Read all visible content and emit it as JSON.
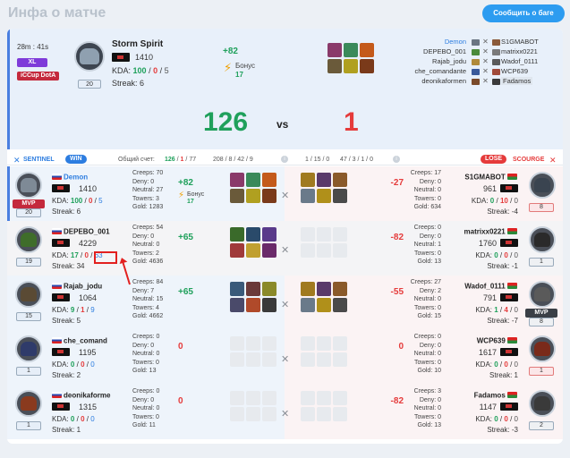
{
  "topbar": {
    "title": "Инфа о матче",
    "report_label": "Сообщить о баге"
  },
  "header": {
    "duration": "28m : 41s",
    "tag_size": "XL",
    "tag_league": "iCCup DotA",
    "level": "20",
    "player_name": "Storm Spirit",
    "mmr": "1410",
    "kda_label": "KDA:",
    "kda_k": "100",
    "kda_sep1": "/",
    "kda_d": "0",
    "kda_sep2": "/",
    "kda_a": "5",
    "streak": "Streak: 6",
    "delta": "+82",
    "bonus_label": "Бонус",
    "bonus_value": "17",
    "score_left": "126",
    "vs": "vs",
    "score_right": "1",
    "roster": [
      {
        "left": "Demon",
        "right": "S1GMABOT"
      },
      {
        "left": "DEPEBO_001",
        "right": "matrixx0221"
      },
      {
        "left": "Rajab_jodu",
        "right": "Wadof_0111"
      },
      {
        "left": "che_comandante",
        "right": "WCP639"
      },
      {
        "left": "deonikaformen",
        "right": "Fadamos"
      }
    ]
  },
  "teambar": {
    "sentinel": "SENTINEL",
    "win": "WIN",
    "score_label": "Общий счет:",
    "score_l_1": "126",
    "score_l_sep": "/",
    "score_l_2": "1",
    "score_l_sep2": "/",
    "score_l_3": "77",
    "totals_left": "208 / 8 / 42 / 9",
    "info": "i",
    "score_r": "1 / 15 / 0",
    "totals_right": "47 / 3 / 1 / 0",
    "lose": "LOSE",
    "scourge": "SCOURGE"
  },
  "colors": {
    "accent": "#2d9cf0",
    "win": "#1fa05b",
    "lose": "#e53b3b",
    "brand_purple": "#7e3bd9"
  },
  "rows": [
    {
      "left": {
        "name": "Demon",
        "mmr": "1410",
        "kda_k": "100",
        "kda_d": "0",
        "kda_a": "5",
        "streak": "Streak: 6",
        "level": "20",
        "mvp": "MVP"
      },
      "stats_left": [
        "Creeps: 70",
        "Deny: 0",
        "Neutral: 27",
        "Towers: 3",
        "Gold: 1283"
      ],
      "delta_left": "+82",
      "bonus_label": "Бонус",
      "bonus_value": "17",
      "right": {
        "name": "S1GMABOT",
        "mmr": "961",
        "kda_k": "0",
        "kda_d": "10",
        "kda_a": "0",
        "streak": "Streak: -4",
        "level": "8"
      },
      "stats_right": [
        "Creeps: 17",
        "Deny: 0",
        "Neutral: 0",
        "Towers: 0",
        "Gold: 634"
      ],
      "delta_right": "-27"
    },
    {
      "left": {
        "name": "DEPEBO_001",
        "mmr": "4229",
        "kda_k": "17",
        "kda_d": "0",
        "kda_a": "63",
        "streak": "Streak: 34",
        "level": "19"
      },
      "stats_left": [
        "Creeps: 54",
        "Deny: 0",
        "Neutral: 0",
        "Towers: 2",
        "Gold: 4636"
      ],
      "delta_left": "+65",
      "right": {
        "name": "matrixx0221",
        "mmr": "1760",
        "kda_k": "0",
        "kda_d": "0",
        "kda_a": "0",
        "streak": "Streak: -1",
        "level": "1"
      },
      "stats_right": [
        "Creeps: 0",
        "Deny: 0",
        "Neutral: 1",
        "Towers: 0",
        "Gold: 13"
      ],
      "delta_right": "-82"
    },
    {
      "left": {
        "name": "Rajab_jodu",
        "mmr": "1064",
        "kda_k": "9",
        "kda_d": "1",
        "kda_a": "9",
        "streak": "Streak: 5",
        "level": "15"
      },
      "stats_left": [
        "Creeps: 84",
        "Deny: 7",
        "Neutral: 15",
        "Towers: 4",
        "Gold: 4662"
      ],
      "delta_left": "+65",
      "right": {
        "name": "Wadof_0111",
        "mmr": "791",
        "kda_k": "1",
        "kda_d": "4",
        "kda_a": "0",
        "streak": "Streak: -7",
        "level": "8",
        "mvp": "MVP"
      },
      "stats_right": [
        "Creeps: 27",
        "Deny: 2",
        "Neutral: 0",
        "Towers: 0",
        "Gold: 15"
      ],
      "delta_right": "-55"
    },
    {
      "left": {
        "name": "che_comand",
        "mmr": "1195",
        "kda_k": "0",
        "kda_d": "0",
        "kda_a": "0",
        "streak": "Streak: 2",
        "level": "1"
      },
      "stats_left": [
        "Creeps: 0",
        "Deny: 0",
        "Neutral: 0",
        "Towers: 0",
        "Gold: 13"
      ],
      "delta_left": "0",
      "right": {
        "name": "WCP639",
        "mmr": "1617",
        "kda_k": "0",
        "kda_d": "0",
        "kda_a": "0",
        "streak": "Streak: 1",
        "level": "1"
      },
      "stats_right": [
        "Creeps: 0",
        "Deny: 0",
        "Neutral: 0",
        "Towers: 0",
        "Gold: 10"
      ],
      "delta_right": "0"
    },
    {
      "left": {
        "name": "deonikaforme",
        "mmr": "1315",
        "kda_k": "0",
        "kda_d": "0",
        "kda_a": "0",
        "streak": "Streak: 1",
        "level": "1"
      },
      "stats_left": [
        "Creeps: 0",
        "Deny: 0",
        "Neutral: 0",
        "Towers: 0",
        "Gold: 11"
      ],
      "delta_left": "0",
      "right": {
        "name": "Fadamos",
        "mmr": "1147",
        "kda_k": "0",
        "kda_d": "0",
        "kda_a": "0",
        "streak": "Streak: -3",
        "level": "2"
      },
      "stats_right": [
        "Creeps: 3",
        "Deny: 0",
        "Neutral: 0",
        "Towers: 0",
        "Gold: 13"
      ],
      "delta_right": "-82"
    }
  ],
  "kda_label": "KDA:",
  "sep": "/"
}
